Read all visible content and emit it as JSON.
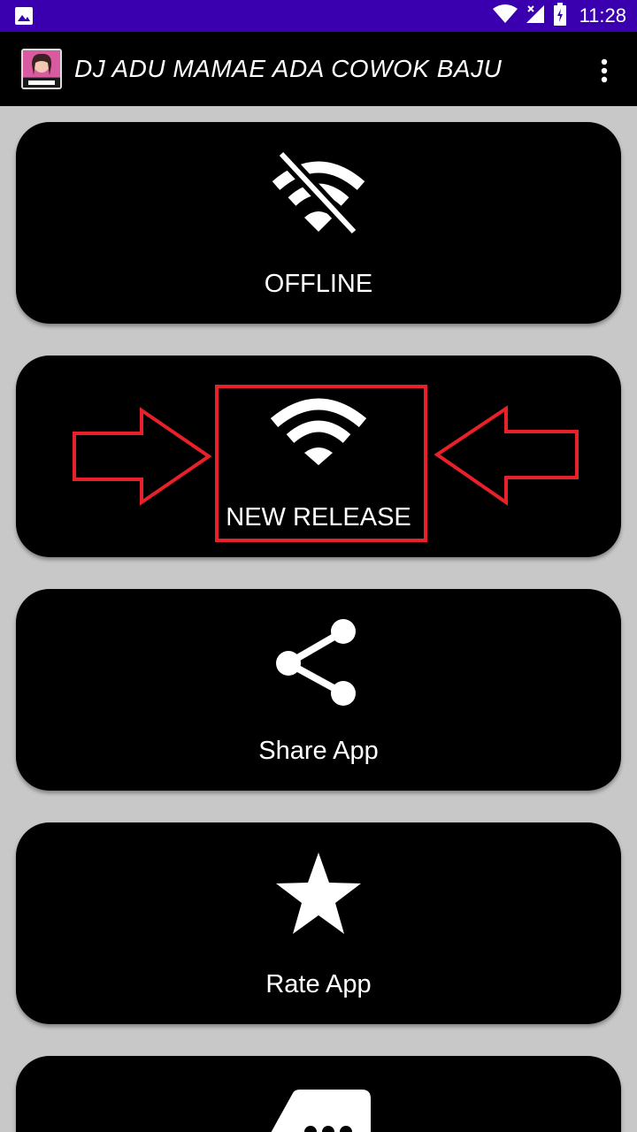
{
  "status_bar": {
    "time": "11:28",
    "icons": [
      "image-icon",
      "wifi-icon",
      "signal-icon",
      "battery-icon"
    ]
  },
  "app_bar": {
    "title": "DJ ADU MAMAE ADA COWOK BAJU",
    "logo_text": "ADU MAMAE",
    "menu_icon": "more-vert-icon"
  },
  "menu": {
    "items": [
      {
        "label": "OFFLINE",
        "icon": "wifi-off-icon"
      },
      {
        "label": "NEW RELEASE",
        "icon": "wifi-icon"
      },
      {
        "label": "Share App",
        "icon": "share-icon"
      },
      {
        "label": "Rate App",
        "icon": "star-icon"
      },
      {
        "label": "",
        "icon": "message-icon"
      }
    ]
  },
  "annotation": {
    "highlight_color": "#e8202a"
  },
  "colors": {
    "status_bar": "#3a00b0",
    "app_bar": "#000000",
    "background": "#c8c8c8",
    "card": "#000000"
  }
}
